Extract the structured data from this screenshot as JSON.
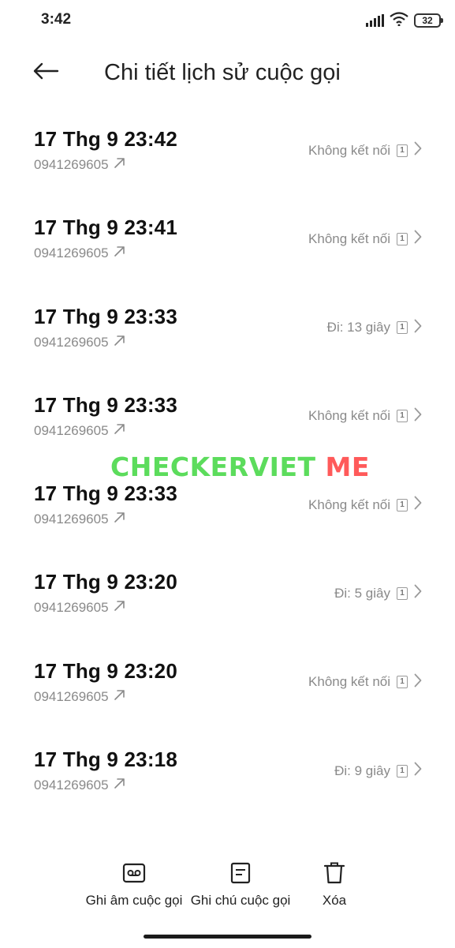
{
  "status_bar": {
    "time": "3:42",
    "battery": "32",
    "icons": [
      "signal-icon",
      "wifi-icon",
      "battery-icon"
    ]
  },
  "header": {
    "back_icon": "arrow-left-icon",
    "title": "Chi tiết lịch sử cuộc gọi"
  },
  "calls": [
    {
      "datetime": "17 Thg 9 23:42",
      "number": "0941269605",
      "status": "Không kết nối",
      "sim": "1",
      "direction": "outgoing"
    },
    {
      "datetime": "17 Thg 9 23:41",
      "number": "0941269605",
      "status": "Không kết nối",
      "sim": "1",
      "direction": "outgoing"
    },
    {
      "datetime": "17 Thg 9 23:33",
      "number": "0941269605",
      "status": "Đi: 13 giây",
      "sim": "1",
      "direction": "outgoing"
    },
    {
      "datetime": "17 Thg 9 23:33",
      "number": "0941269605",
      "status": "Không kết nối",
      "sim": "1",
      "direction": "outgoing"
    },
    {
      "datetime": "17 Thg 9 23:33",
      "number": "0941269605",
      "status": "Không kết nối",
      "sim": "1",
      "direction": "outgoing"
    },
    {
      "datetime": "17 Thg 9 23:20",
      "number": "0941269605",
      "status": "Đi: 5 giây",
      "sim": "1",
      "direction": "outgoing"
    },
    {
      "datetime": "17 Thg 9 23:20",
      "number": "0941269605",
      "status": "Không kết nối",
      "sim": "1",
      "direction": "outgoing"
    },
    {
      "datetime": "17 Thg 9 23:18",
      "number": "0941269605",
      "status": "Đi: 9 giây",
      "sim": "1",
      "direction": "outgoing"
    }
  ],
  "watermark": {
    "part1": "CHECKERVIET",
    "part2": " ME",
    "color1": "#5cdc5c",
    "color2": "#ff5a5a"
  },
  "actions": {
    "record_label": "Ghi âm cuộc gọi",
    "note_label": "Ghi chú cuộc gọi",
    "delete_label": "Xóa"
  }
}
